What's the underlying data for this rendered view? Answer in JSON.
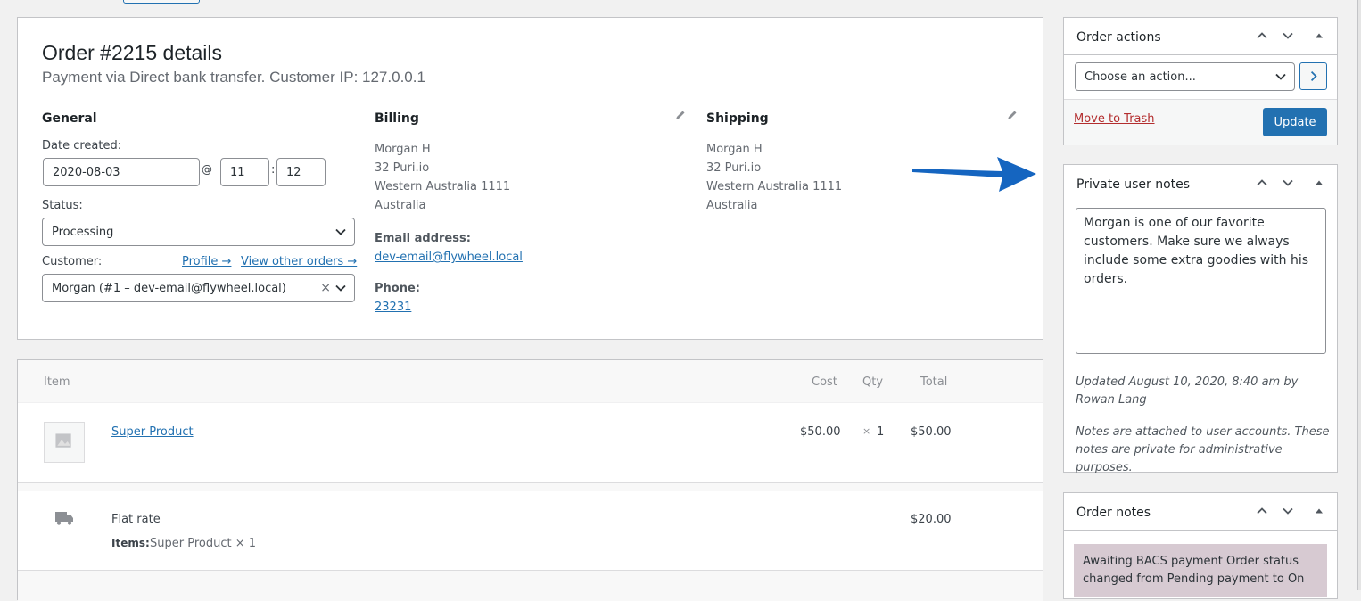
{
  "order": {
    "title": "Order #2215 details",
    "subtitle": "Payment via Direct bank transfer. Customer IP: 127.0.0.1",
    "general": {
      "heading": "General",
      "date_label": "Date created:",
      "date_value": "2020-08-03",
      "at_symbol": "@",
      "hour_value": "11",
      "colon": ":",
      "minute_value": "12",
      "status_label": "Status:",
      "status_value": "Processing",
      "customer_label": "Customer:",
      "profile_link": "Profile →",
      "other_orders_link": "View other orders →",
      "customer_value": "Morgan (#1 – dev-email@flywheel.local)",
      "clear_symbol": "×"
    },
    "billing": {
      "heading": "Billing",
      "name": "Morgan H",
      "street": "32 Puri.io",
      "region": "Western Australia 1111",
      "country": "Australia",
      "email_label": "Email address:",
      "email": "dev-email@flywheel.local",
      "phone_label": "Phone:",
      "phone": "23231"
    },
    "shipping": {
      "heading": "Shipping",
      "name": "Morgan H",
      "street": "32 Puri.io",
      "region": "Western Australia 1111",
      "country": "Australia"
    }
  },
  "items": {
    "columns": {
      "item": "Item",
      "cost": "Cost",
      "qty": "Qty",
      "total": "Total"
    },
    "rows": [
      {
        "name": "Super Product",
        "cost": "$50.00",
        "qty_x": "×",
        "qty": "1",
        "total": "$50.00"
      }
    ],
    "shipping_row": {
      "name": "Flat rate",
      "items_label": "Items:",
      "items_value": "Super Product × 1",
      "total": "$20.00"
    }
  },
  "sidebar": {
    "order_actions": {
      "title": "Order actions",
      "select_value": "Choose an action...",
      "trash_label": "Move to Trash",
      "update_label": "Update"
    },
    "private_notes": {
      "title": "Private user notes",
      "note_text": "Morgan is one of our favorite customers. Make sure we always include some extra goodies with his orders.",
      "updated": "Updated August 10, 2020, 8:40 am by Rowan Lang",
      "info": "Notes are attached to user accounts. These notes are private for administrative purposes."
    },
    "order_notes": {
      "title": "Order notes",
      "note_text": "Awaiting BACS payment Order status changed from Pending payment to On"
    }
  },
  "colors": {
    "accent": "#2271b1",
    "arrow": "#1565c0",
    "trash": "#b32d2e",
    "note_bubble": "#d7cad2"
  }
}
